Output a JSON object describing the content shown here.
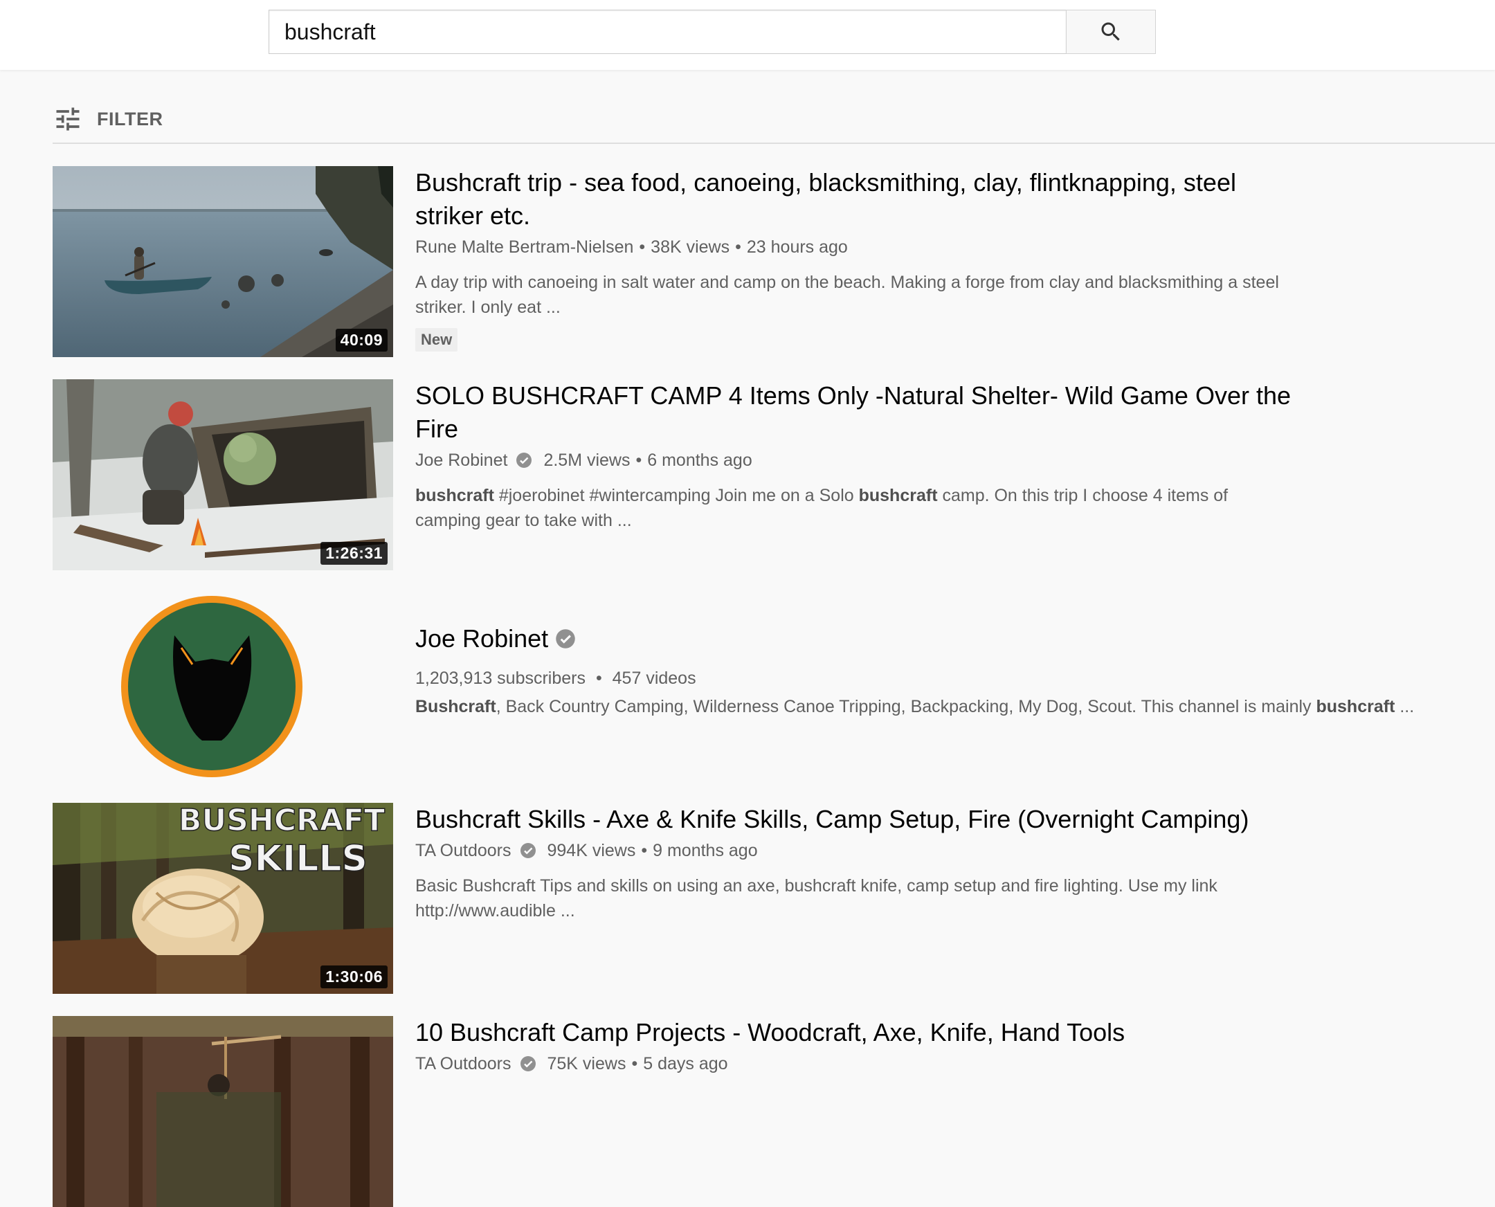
{
  "search": {
    "value": "bushcraft",
    "button_icon": "search-icon"
  },
  "filter": {
    "label": "FILTER",
    "icon": "tune-icon"
  },
  "colors": {
    "verified": "#909090",
    "avatar_ring": "#f2921b",
    "avatar_fill": "#2e6740"
  },
  "results": [
    {
      "type": "video",
      "title": "Bushcraft trip - sea food, canoeing, blacksmithing, clay, flintknapping, steel striker etc.",
      "channel": "Rune Malte Bertram-Nielsen",
      "verified": false,
      "views": "38K views",
      "age": "23 hours ago",
      "description": "A day trip with canoeing in salt water and camp on the beach. Making a forge from clay and blacksmithing a steel striker. I only eat ...",
      "duration": "40:09",
      "badge": "New"
    },
    {
      "type": "video",
      "title": "SOLO BUSHCRAFT CAMP 4 Items Only -Natural Shelter- Wild Game Over the Fire",
      "channel": "Joe Robinet",
      "verified": true,
      "views": "2.5M views",
      "age": "6 months ago",
      "description_parts": [
        {
          "text": "bushcraft",
          "bold": true
        },
        {
          "text": " #joerobinet #wintercamping Join me on a Solo ",
          "bold": false
        },
        {
          "text": "bushcraft",
          "bold": true
        },
        {
          "text": " camp. On this trip I choose 4 items of camping gear to take with ...",
          "bold": false
        }
      ],
      "duration": "1:26:31"
    },
    {
      "type": "channel",
      "name": "Joe Robinet",
      "verified": true,
      "subscribers": "1,203,913 subscribers",
      "videos": "457 videos",
      "description_parts": [
        {
          "text": "Bushcraft",
          "bold": true
        },
        {
          "text": ", Back Country Camping, Wilderness Canoe Tripping, Backpacking, My Dog, Scout. This channel is mainly ",
          "bold": false
        },
        {
          "text": "bushcraft",
          "bold": true
        },
        {
          "text": " ...",
          "bold": false
        }
      ]
    },
    {
      "type": "video",
      "title": "Bushcraft Skills - Axe & Knife Skills, Camp Setup, Fire (Overnight Camping)",
      "channel": "TA Outdoors",
      "verified": true,
      "views": "994K views",
      "age": "9 months ago",
      "description": "Basic Bushcraft Tips and skills on using an axe, bushcraft knife, camp setup and fire lighting. Use my link http://www.audible ...",
      "duration": "1:30:06",
      "thumb_text": [
        "BUSHCRAFT",
        "SKILLS"
      ]
    },
    {
      "type": "video",
      "title": "10 Bushcraft Camp Projects - Woodcraft, Axe, Knife, Hand Tools",
      "channel": "TA Outdoors",
      "verified": true,
      "views": "75K views",
      "age": "5 days ago"
    }
  ],
  "meta_separator": "•"
}
